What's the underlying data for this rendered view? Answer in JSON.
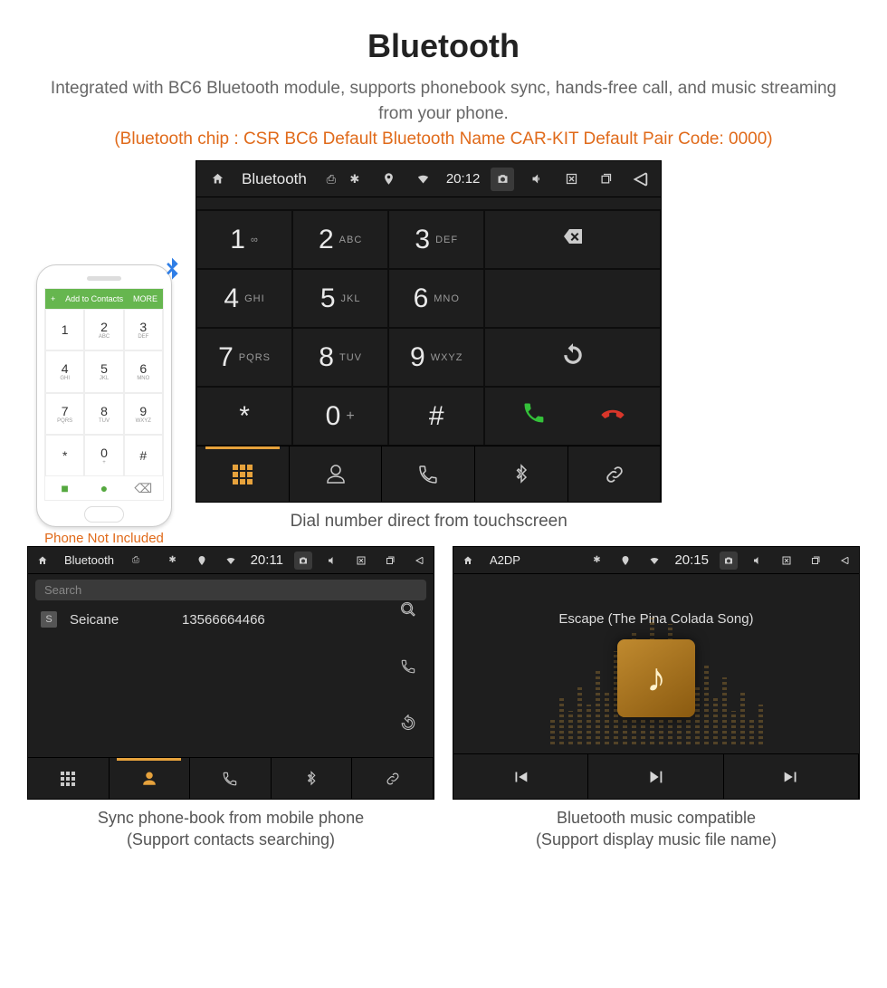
{
  "title": "Bluetooth",
  "description": "Integrated with BC6 Bluetooth module, supports phonebook sync, hands-free call, and music streaming from your phone.",
  "meta": "(Bluetooth chip : CSR BC6     Default Bluetooth Name CAR-KIT     Default Pair Code: 0000)",
  "phone": {
    "topbar_plus": "+",
    "topbar_label": "Add to Contacts",
    "topbar_more": "MORE",
    "keys": [
      {
        "n": "1",
        "s": ""
      },
      {
        "n": "2",
        "s": "ABC"
      },
      {
        "n": "3",
        "s": "DEF"
      },
      {
        "n": "4",
        "s": "GHI"
      },
      {
        "n": "5",
        "s": "JKL"
      },
      {
        "n": "6",
        "s": "MNO"
      },
      {
        "n": "7",
        "s": "PQRS"
      },
      {
        "n": "8",
        "s": "TUV"
      },
      {
        "n": "9",
        "s": "WXYZ"
      },
      {
        "n": "*",
        "s": ""
      },
      {
        "n": "0",
        "s": "+"
      },
      {
        "n": "#",
        "s": ""
      }
    ],
    "caption": "Phone Not Included"
  },
  "dialer": {
    "sb_title": "Bluetooth",
    "time": "20:12",
    "keys": [
      {
        "n": "1",
        "s": "∞"
      },
      {
        "n": "2",
        "s": "ABC"
      },
      {
        "n": "3",
        "s": "DEF"
      },
      {
        "n": "4",
        "s": "GHI"
      },
      {
        "n": "5",
        "s": "JKL"
      },
      {
        "n": "6",
        "s": "MNO"
      },
      {
        "n": "7",
        "s": "PQRS"
      },
      {
        "n": "8",
        "s": "TUV"
      },
      {
        "n": "9",
        "s": "WXYZ"
      },
      {
        "n": "*",
        "s": ""
      },
      {
        "n": "0",
        "s": "+"
      },
      {
        "n": "#",
        "s": ""
      }
    ],
    "caption": "Dial number direct from touchscreen"
  },
  "phonebook": {
    "sb_title": "Bluetooth",
    "time": "20:11",
    "search_placeholder": "Search",
    "contact_badge": "S",
    "contact_name": "Seicane",
    "contact_number": "13566664466",
    "caption_l1": "Sync phone-book from mobile phone",
    "caption_l2": "(Support contacts searching)"
  },
  "music": {
    "sb_title": "A2DP",
    "time": "20:15",
    "track": "Escape (The Pina Colada Song)",
    "caption_l1": "Bluetooth music compatible",
    "caption_l2": "(Support display music file name)"
  }
}
